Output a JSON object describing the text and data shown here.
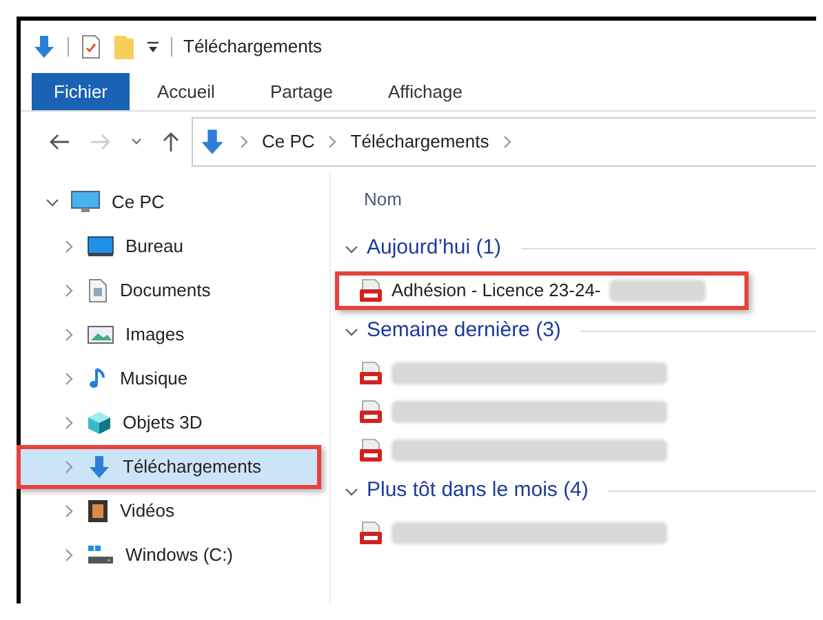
{
  "window": {
    "title": "Téléchargements"
  },
  "ribbon_tabs": [
    {
      "label": "Fichier",
      "selected": true
    },
    {
      "label": "Accueil",
      "selected": false
    },
    {
      "label": "Partage",
      "selected": false
    },
    {
      "label": "Affichage",
      "selected": false
    }
  ],
  "address_bar": {
    "path": [
      "Ce PC",
      "Téléchargements"
    ]
  },
  "sidebar": {
    "root": {
      "label": "Ce PC",
      "expanded": true,
      "children": [
        {
          "label": "Bureau",
          "kind": "desktop",
          "selected": false,
          "highlighted": false
        },
        {
          "label": "Documents",
          "kind": "documents",
          "selected": false,
          "highlighted": false
        },
        {
          "label": "Images",
          "kind": "images",
          "selected": false,
          "highlighted": false
        },
        {
          "label": "Musique",
          "kind": "music",
          "selected": false,
          "highlighted": false
        },
        {
          "label": "Objets 3D",
          "kind": "objects3d",
          "selected": false,
          "highlighted": false
        },
        {
          "label": "Téléchargements",
          "kind": "downloads",
          "selected": true,
          "highlighted": true
        },
        {
          "label": "Vidéos",
          "kind": "videos",
          "selected": false,
          "highlighted": false
        },
        {
          "label": "Windows (C:)",
          "kind": "drive",
          "selected": false,
          "highlighted": false
        }
      ]
    }
  },
  "file_list": {
    "column": "Nom",
    "groups": [
      {
        "title": "Aujourd’hui (1)",
        "expanded": true,
        "files": [
          {
            "name": "Adhésion - Licence 23-24-",
            "redacted": true,
            "highlighted": true
          }
        ]
      },
      {
        "title": "Semaine dernière (3)",
        "expanded": true,
        "files": [
          {
            "redacted": true,
            "highlighted": false
          },
          {
            "redacted": true,
            "highlighted": false
          },
          {
            "redacted": true,
            "highlighted": false
          }
        ]
      },
      {
        "title": "Plus tôt dans le mois (4)",
        "expanded": true,
        "files": [
          {
            "redacted": true,
            "highlighted": false
          }
        ]
      }
    ]
  }
}
